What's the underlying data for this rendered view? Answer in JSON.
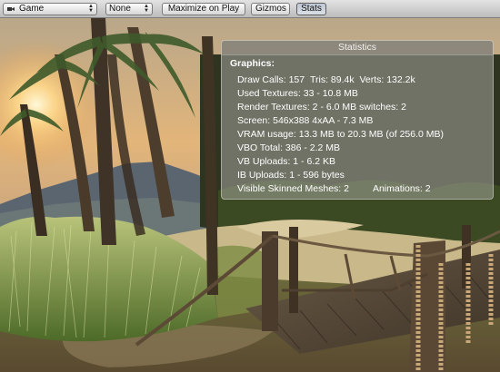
{
  "toolbar": {
    "aspect_dropdown": {
      "value": "Game",
      "icon": "camera-icon"
    },
    "second_dropdown": {
      "value": "None"
    },
    "maximize_button": "Maximize on Play",
    "gizmos_button": "Gizmos",
    "stats_button": "Stats"
  },
  "stats": {
    "title": "Statistics",
    "heading": "Graphics:",
    "draw_calls": "Draw Calls: 157",
    "tris": "Tris: 89.4k",
    "verts": "Verts: 132.2k",
    "used_textures": "Used Textures: 33 - 10.8 MB",
    "render_textures": "Render Textures: 2 - 6.0 MB switches: 2",
    "screen": "Screen: 546x388 4xAA - 7.3 MB",
    "vram": "VRAM usage: 13.3 MB to 20.3 MB (of 256.0 MB)",
    "vbo_total": "VBO Total: 386 - 2.2 MB",
    "vb_uploads": "VB Uploads: 1 - 6.2 KB",
    "ib_uploads": "IB Uploads: 1 - 596 bytes",
    "skinned_meshes": "Visible Skinned Meshes: 2",
    "animations": "Animations: 2"
  },
  "colors": {
    "toolbar": "#cfcfcf",
    "stats_panel": "#a5a59e",
    "stats_text": "#ffffff",
    "sky_sunset": "#e8b06a"
  }
}
